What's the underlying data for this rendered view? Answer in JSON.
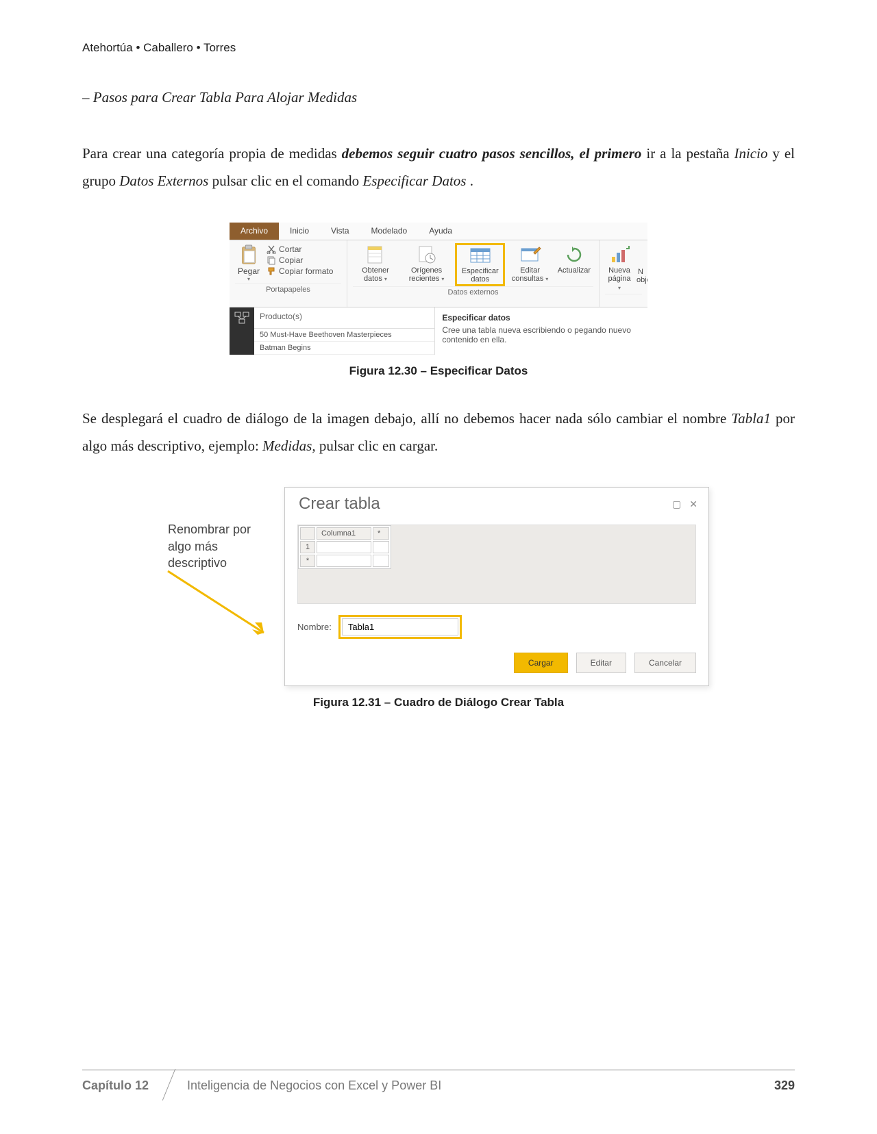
{
  "header": {
    "authors": "Atehortúa • Caballero • Torres"
  },
  "section": {
    "subheading": "– Pasos para Crear Tabla Para Alojar Medidas",
    "para1_a": "Para crear una categoría propia de medidas ",
    "para1_b": "debemos seguir cuatro pasos sencillos, el primero",
    "para1_c": " ir a la pestaña ",
    "para1_d": "Inicio",
    "para1_e": " y el grupo ",
    "para1_f": "Datos Externos",
    "para1_g": " pulsar clic en el comando ",
    "para1_h": "Especificar Datos",
    "para1_i": ".",
    "para2_a": "Se desplegará el cuadro de diálogo de la imagen debajo, allí no debemos hacer nada sólo cambiar el nombre ",
    "para2_b": "Tabla1",
    "para2_c": " por algo más descriptivo, ejemplo: ",
    "para2_d": "Medidas,",
    "para2_e": " pulsar clic en cargar."
  },
  "fig1": {
    "caption": "Figura 12.30 – Especificar Datos",
    "tabs": {
      "archivo": "Archivo",
      "inicio": "Inicio",
      "vista": "Vista",
      "modelado": "Modelado",
      "ayuda": "Ayuda"
    },
    "clipboard": {
      "paste": "Pegar",
      "cut": "Cortar",
      "copy": "Copiar",
      "format": "Copiar formato",
      "group": "Portapapeles"
    },
    "externos": {
      "obtener": "Obtener datos",
      "origenes": "Orígenes recientes",
      "especificar": "Especificar datos",
      "editar": "Editar consultas",
      "actualizar": "Actualizar",
      "group": "Datos externos"
    },
    "insertar": {
      "nueva": "Nueva página",
      "obje": "N obje"
    },
    "tooltip": {
      "title": "Especificar datos",
      "body": "Cree una tabla nueva escribiendo o pegando nuevo contenido en ella."
    },
    "list": {
      "header": "Producto(s)",
      "r1": "50 Must-Have Beethoven Masterpieces",
      "r2": "Batman Begins"
    }
  },
  "fig2": {
    "caption": "Figura 12.31 – Cuadro de Diálogo Crear Tabla",
    "annotation": "Renombrar por algo más descriptivo",
    "title": "Crear tabla",
    "col1": "Columna1",
    "star": "*",
    "row1": "1",
    "name_label": "Nombre:",
    "name_value": "Tabla1",
    "btn_cargar": "Cargar",
    "btn_editar": "Editar",
    "btn_cancelar": "Cancelar"
  },
  "footer": {
    "chapter": "Capítulo 12",
    "title": "Inteligencia de Negocios con Excel y Power BI",
    "page": "329"
  }
}
